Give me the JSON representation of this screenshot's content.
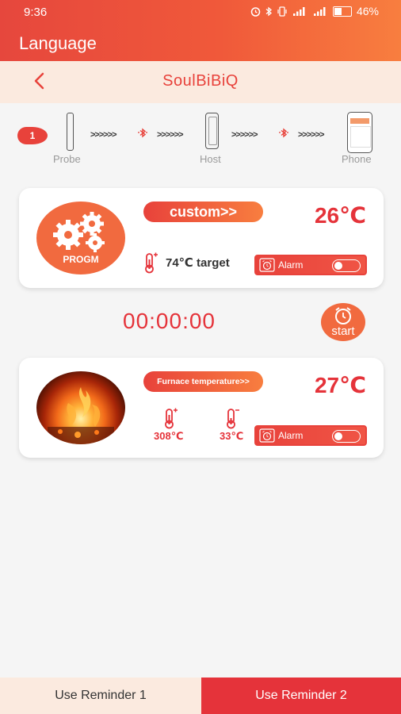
{
  "status_bar": {
    "time": "9:36",
    "battery_percent": "46%",
    "battery_level": 0.46
  },
  "topbar": {
    "title": "Language"
  },
  "header": {
    "title": "SoulBiBiQ",
    "back_icon": "chevron-left-icon"
  },
  "connection_flow": {
    "step_number": "1",
    "arrows": ">>>>>>",
    "steps": [
      {
        "label": "Probe",
        "icon": "probe-icon"
      },
      {
        "label": "Host",
        "icon": "host-device-icon"
      },
      {
        "label": "Phone",
        "icon": "phone-icon"
      }
    ],
    "link_icon": "bluetooth-icon"
  },
  "probe_card": {
    "program_label": "PROGM",
    "mode_button": "custom>>",
    "current_temp": "26℃",
    "target_temp": "74℃",
    "target_suffix": "target",
    "alarm_label": "Alarm",
    "alarm_on": false
  },
  "timer": {
    "value": "00:00:00",
    "start_label": "start"
  },
  "furnace_card": {
    "mode_button": "Furnace temperature>>",
    "current_temp": "27℃",
    "high_limit": "308℃",
    "low_limit": "33℃",
    "alarm_label": "Alarm",
    "alarm_on": false
  },
  "bottom_tabs": {
    "reminder_1": "Use Reminder 1",
    "reminder_2": "Use Reminder 2",
    "active": "reminder_2"
  },
  "colors": {
    "accent_red": "#e5333a",
    "accent_orange": "#f87e3f",
    "header_bg": "#fbeadf"
  }
}
